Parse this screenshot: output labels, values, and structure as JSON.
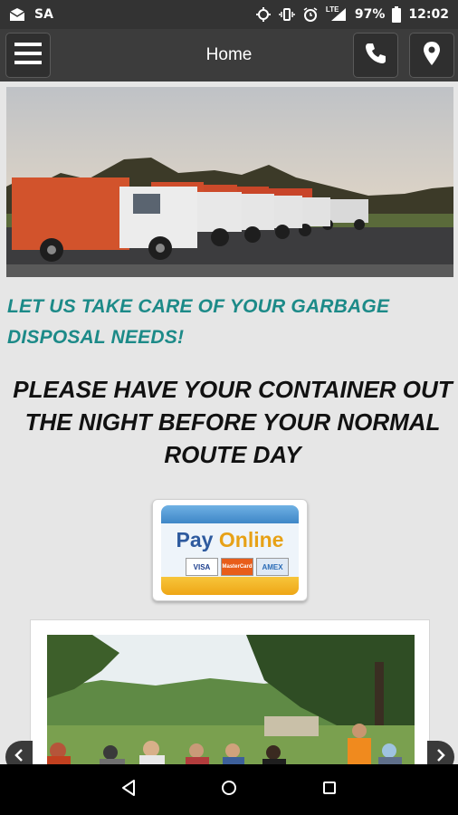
{
  "status_bar": {
    "carrier": "SA",
    "network": "LTE",
    "battery": "97%",
    "battery_level": 0.97,
    "time": "12:02"
  },
  "app_bar": {
    "title": "Home",
    "icons": [
      "menu-icon",
      "phone-icon",
      "location-pin-icon"
    ]
  },
  "main": {
    "hero_image": "garbage-trucks-photo",
    "tagline": "LET US TAKE CARE OF YOUR GARBAGE DISPOSAL NEEDS!",
    "notice": "PLEASE HAVE YOUR CONTAINER OUT THE NIGHT BEFORE YOUR NORMAL ROUTE DAY",
    "pay_online": {
      "word1": "Pay",
      "word2": "Online",
      "cards": [
        "VISA",
        "MasterCard",
        "AMEX"
      ]
    },
    "gallery_image": "community-event-photo"
  },
  "nav_bar": {
    "icons": [
      "back-icon",
      "home-icon",
      "recents-icon"
    ]
  },
  "colors": {
    "accent_teal": "#1c8a88",
    "app_bar": "#3c3c3c",
    "status_bar": "#333333",
    "pay_blue": "#2e5a9e",
    "pay_gold": "#e7a116"
  }
}
